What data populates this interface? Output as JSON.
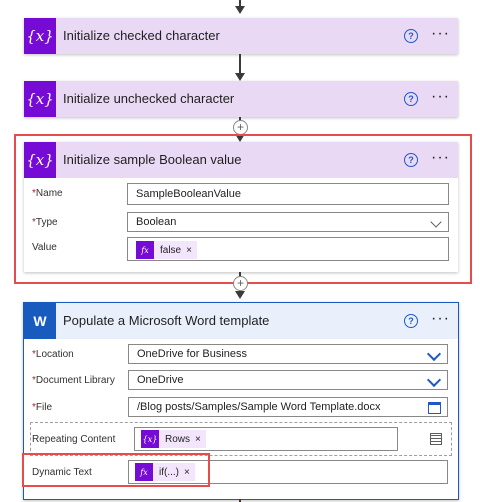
{
  "steps": {
    "checked": {
      "title": "Initialize checked character",
      "icon": "{x}"
    },
    "unchecked": {
      "title": "Initialize unchecked character",
      "icon": "{x}"
    },
    "sample": {
      "title": "Initialize sample Boolean value",
      "icon": "{x}",
      "name_label": "Name",
      "name_value": "SampleBooleanValue",
      "type_label": "Type",
      "type_value": "Boolean",
      "value_label": "Value",
      "value_token_icon": "fx",
      "value_token": "false"
    },
    "word": {
      "title": "Populate a Microsoft Word template",
      "icon": "W",
      "location_label": "Location",
      "location_value": "OneDrive for Business",
      "library_label": "Document Library",
      "library_value": "OneDrive",
      "file_label": "File",
      "file_value": "/Blog posts/Samples/Sample Word Template.docx",
      "repeating_label": "Repeating Content",
      "repeating_token_icon": "{x}",
      "repeating_token": "Rows",
      "dynamic_label": "Dynamic Text",
      "dynamic_token_icon": "fx",
      "dynamic_token": "if(...)"
    }
  },
  "common": {
    "help": "?",
    "more": "···",
    "required": "*",
    "remove": "×",
    "add": "+"
  },
  "colors": {
    "variable_accent": "#770bd6",
    "variable_header": "#e9d9f5",
    "word_accent": "#185abd",
    "highlight": "#e74c4c"
  }
}
